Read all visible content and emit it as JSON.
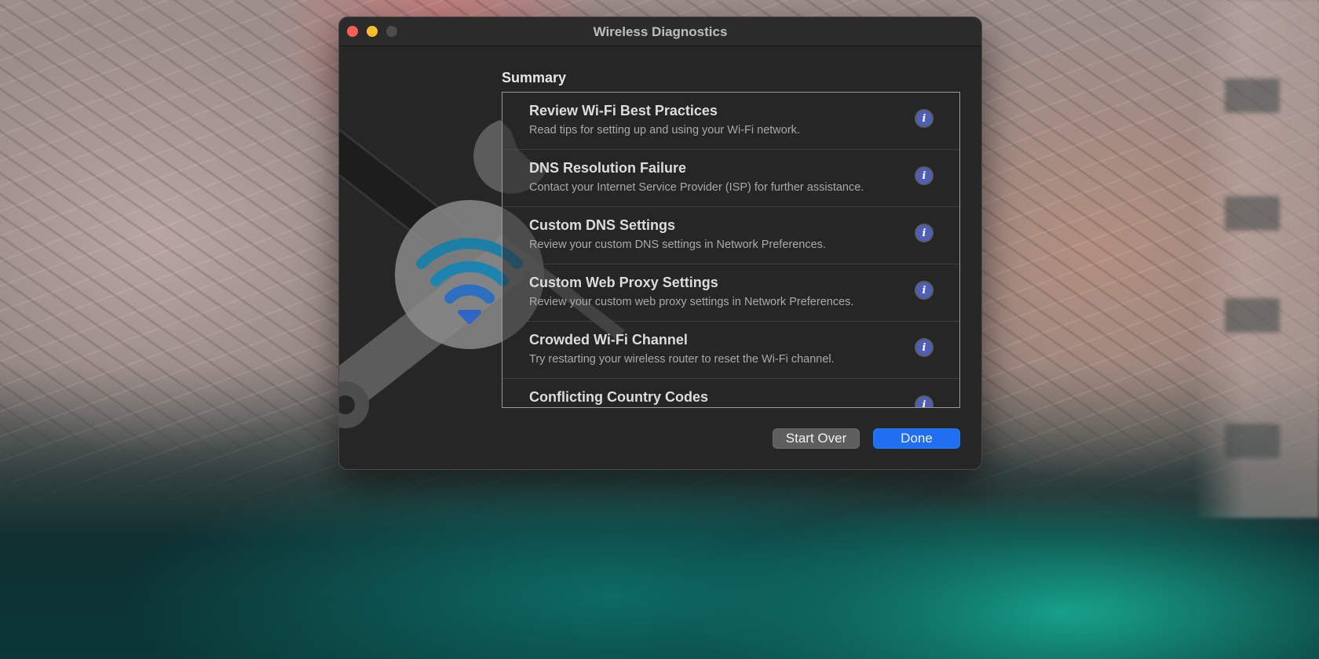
{
  "window": {
    "title": "Wireless Diagnostics"
  },
  "summary": {
    "heading": "Summary",
    "items": [
      {
        "title": "Review Wi-Fi Best Practices",
        "description": "Read tips for setting up and using your Wi-Fi network.",
        "icon": "info-icon"
      },
      {
        "title": "DNS Resolution Failure",
        "description": "Contact your Internet Service Provider (ISP) for further assistance.",
        "icon": "info-icon"
      },
      {
        "title": "Custom DNS Settings",
        "description": "Review your custom DNS settings in Network Preferences.",
        "icon": "info-icon"
      },
      {
        "title": "Custom Web Proxy Settings",
        "description": "Review your custom web proxy settings in Network Preferences.",
        "icon": "info-icon"
      },
      {
        "title": "Crowded Wi-Fi Channel",
        "description": "Try restarting your wireless router to reset the Wi-Fi channel.",
        "icon": "info-icon"
      },
      {
        "title": "Conflicting Country Codes",
        "description": "",
        "icon": "info-icon"
      }
    ]
  },
  "buttons": {
    "start_over": "Start Over",
    "done": "Done"
  },
  "colors": {
    "close": "#fe5f57",
    "minimize": "#febc2e",
    "zoom_disabled": "#4c4c4c",
    "accent": "#1f6ff0",
    "info": "#4d5fb7"
  }
}
